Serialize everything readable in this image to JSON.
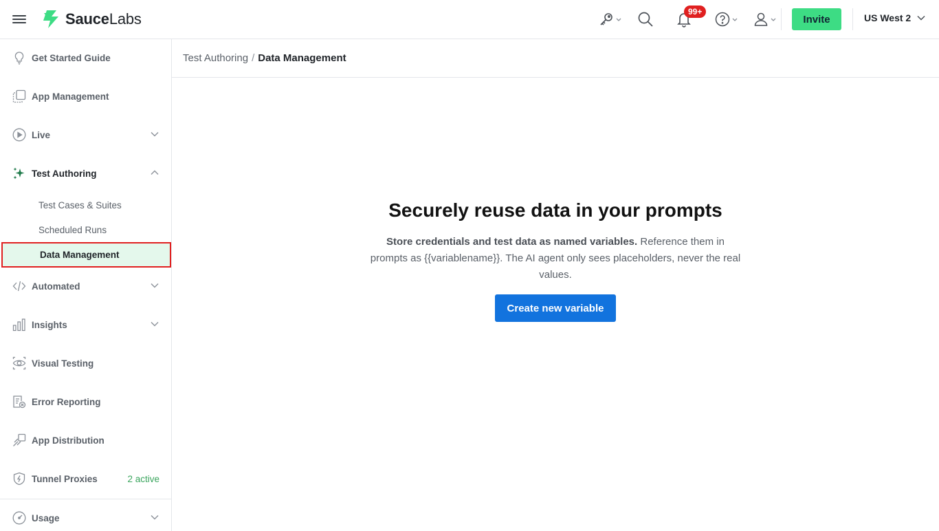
{
  "brand": {
    "name_bold": "Sauce",
    "name_light": "Labs",
    "accent": "#3ddc84"
  },
  "header": {
    "notifications_badge": "99+",
    "invite_label": "Invite",
    "region_label": "US West 2",
    "icons": [
      "menu-icon",
      "key-icon",
      "search-icon",
      "bell-icon",
      "help-icon",
      "user-icon"
    ]
  },
  "sidebar": {
    "items": [
      {
        "label": "Get Started Guide",
        "icon": "lightbulb-icon"
      },
      {
        "label": "App Management",
        "icon": "app-management-icon"
      },
      {
        "label": "Live",
        "icon": "play-circle-icon"
      },
      {
        "label": "Test Authoring",
        "icon": "sparkle-icon"
      },
      {
        "label": "Automated",
        "icon": "code-icon"
      },
      {
        "label": "Insights",
        "icon": "bar-chart-icon"
      },
      {
        "label": "Visual Testing",
        "icon": "eye-icon"
      },
      {
        "label": "Error Reporting",
        "icon": "error-report-icon"
      },
      {
        "label": "App Distribution",
        "icon": "distribution-icon"
      },
      {
        "label": "Tunnel Proxies",
        "icon": "shield-icon",
        "extra": "2 active"
      },
      {
        "label": "Usage",
        "icon": "gauge-icon"
      }
    ],
    "test_authoring_children": [
      {
        "label": "Test Cases & Suites"
      },
      {
        "label": "Scheduled Runs"
      },
      {
        "label": "Data Management"
      }
    ]
  },
  "breadcrumb": {
    "parent": "Test Authoring",
    "separator": "/",
    "current": "Data Management"
  },
  "main": {
    "title": "Securely reuse data in your prompts",
    "desc_bold": "Store credentials and test data as named variables.",
    "desc_rest": " Reference them in prompts as {{variablename}}. The AI agent only sees placeholders, never the real values.",
    "cta_label": "Create new variable"
  }
}
